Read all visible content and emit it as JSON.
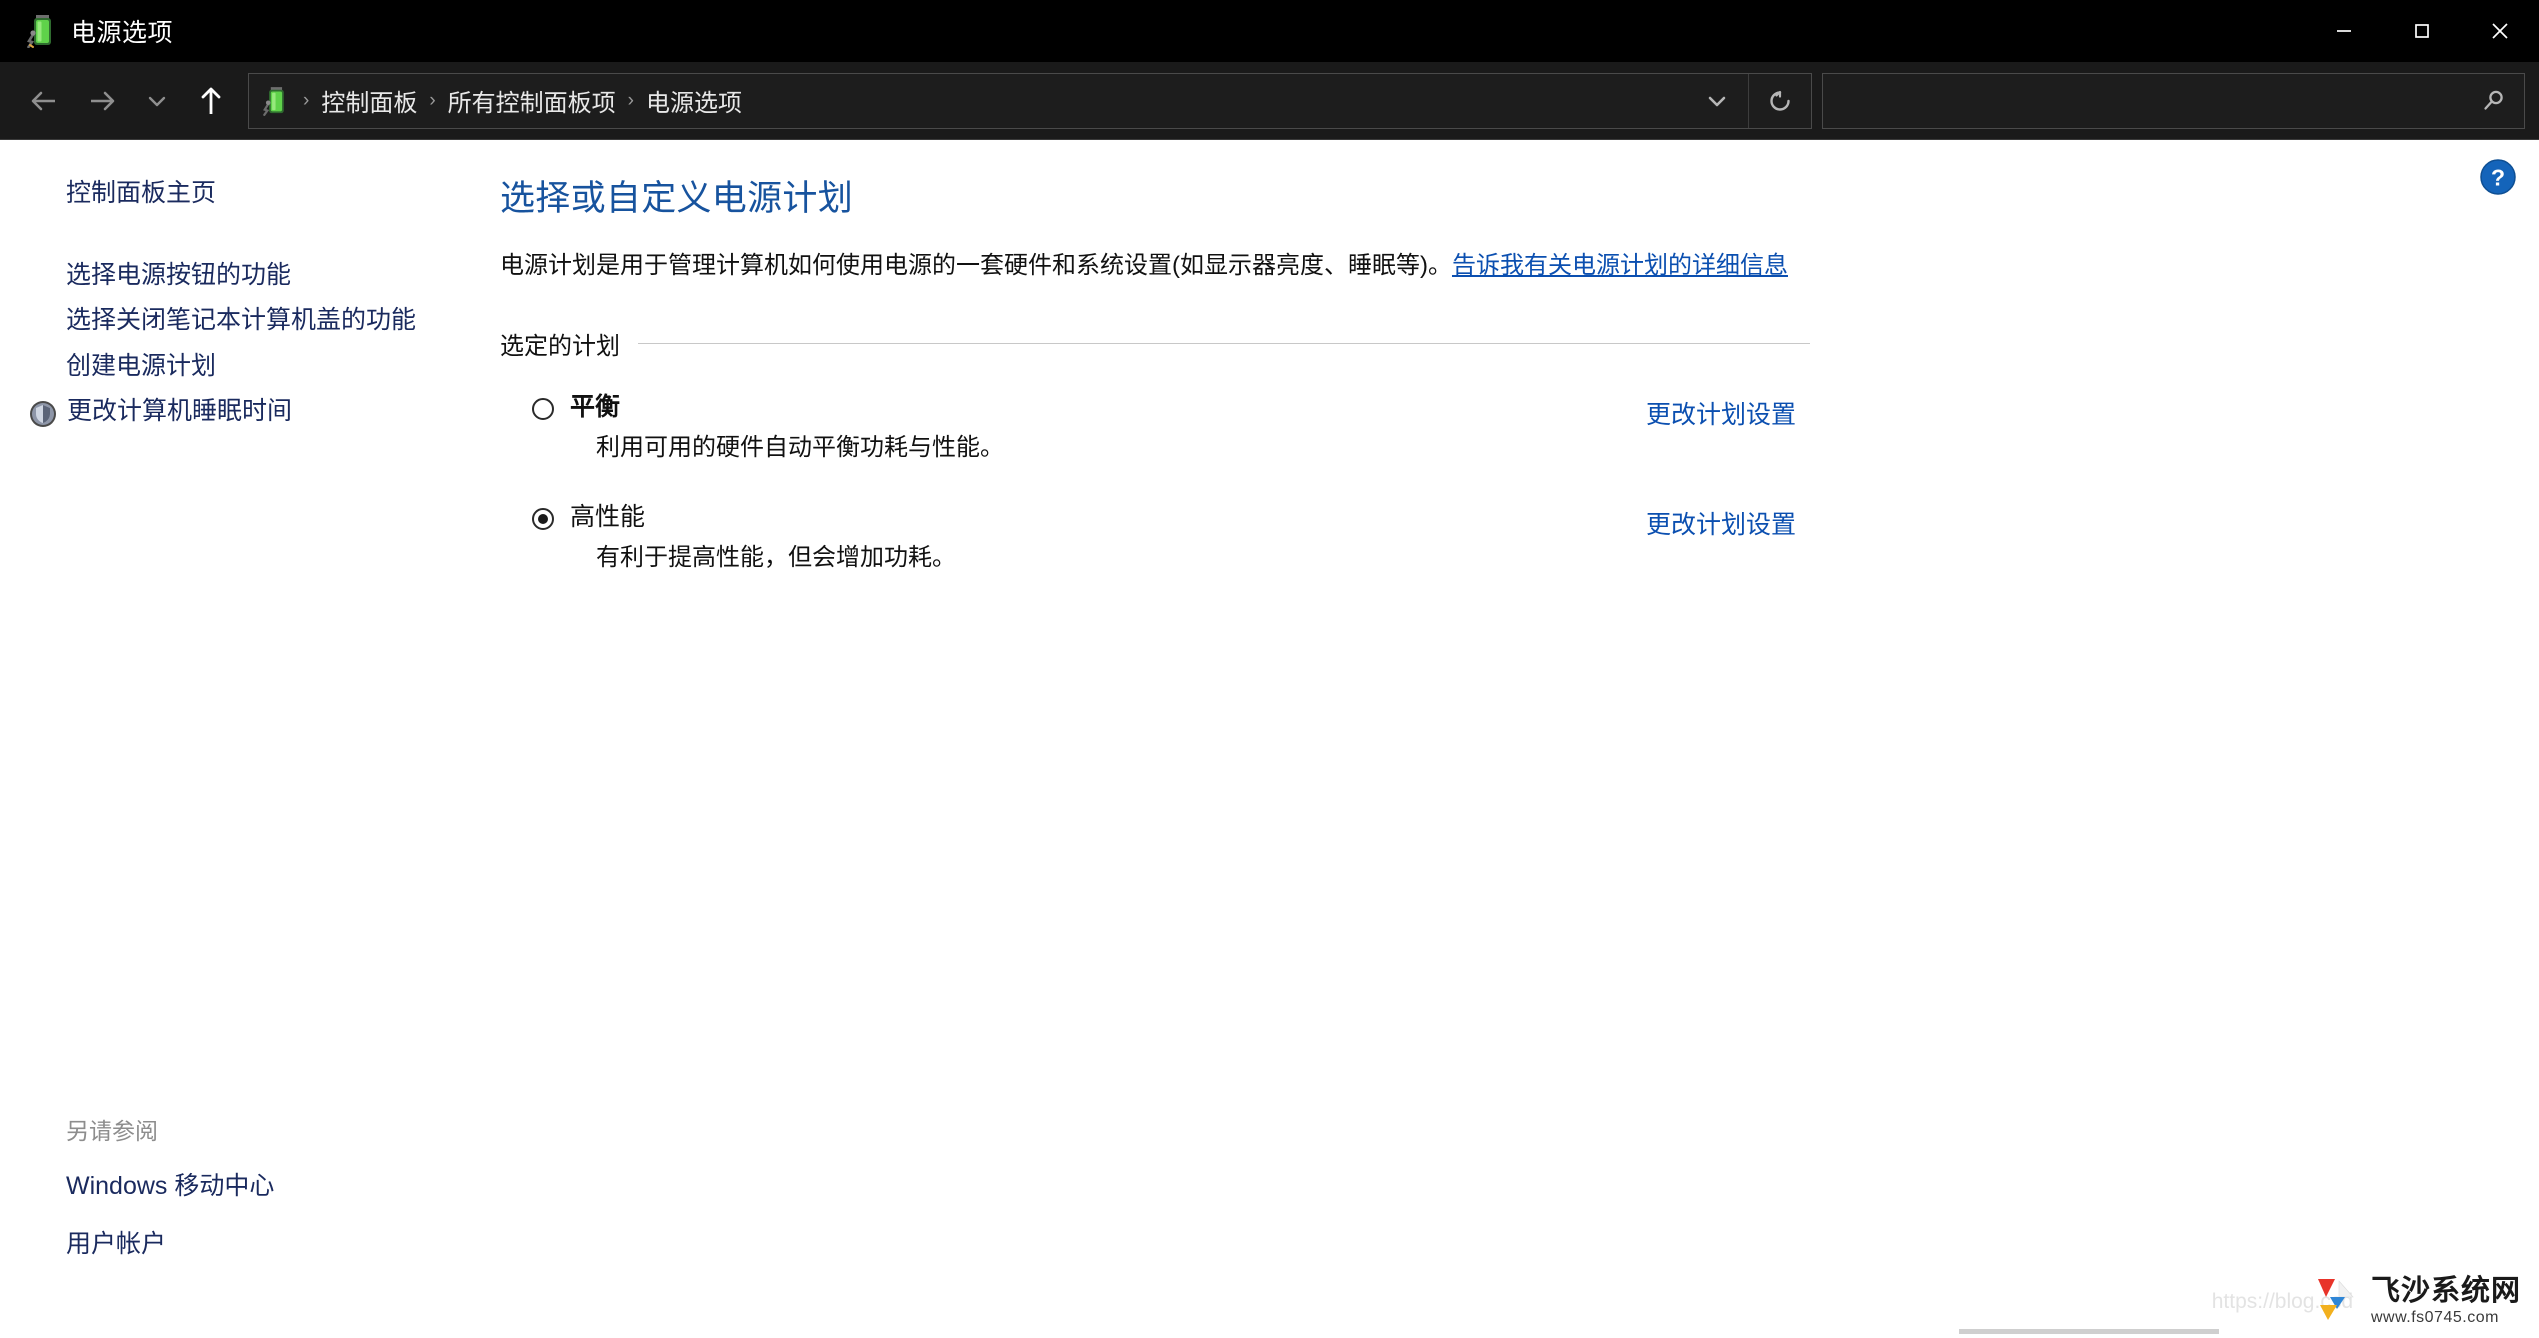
{
  "window": {
    "title": "电源选项",
    "app_icon": "battery-icon",
    "controls": {
      "minimize": "minimize-icon",
      "maximize": "maximize-icon",
      "close": "close-icon"
    }
  },
  "navbar": {
    "back": "back-arrow-icon",
    "forward": "forward-arrow-icon",
    "recent": "chevron-down-icon",
    "up": "up-arrow-icon",
    "address_icon": "battery-icon",
    "breadcrumbs": [
      "控制面板",
      "所有控制面板项",
      "电源选项"
    ],
    "separator": "›",
    "dropdown": "chevron-down-icon",
    "refresh": "refresh-icon",
    "search": {
      "placeholder": "",
      "value": "",
      "icon": "search-icon"
    }
  },
  "sidebar": {
    "home_label": "控制面板主页",
    "links": [
      {
        "label": "选择电源按钮的功能",
        "icon": null
      },
      {
        "label": "选择关闭笔记本计算机盖的功能",
        "icon": null
      },
      {
        "label": "创建电源计划",
        "icon": null
      },
      {
        "label": "更改计算机睡眠时间",
        "icon": "shield-icon"
      }
    ],
    "see_also": {
      "title": "另请参阅",
      "links": [
        "Windows 移动中心",
        "用户帐户"
      ]
    }
  },
  "main": {
    "page_title": "选择或自定义电源计划",
    "description_part1": "电源计划是用于管理计算机如何使用电源的一套硬件和系统设置(如显示器亮度、睡眠等)。",
    "description_link": "告诉我有关电源计划的详细信息",
    "group_label": "选定的计划",
    "plans": [
      {
        "name": "平衡",
        "description": "利用可用的硬件自动平衡功耗与性能。",
        "selected": false,
        "bold": true,
        "action_label": "更改计划设置"
      },
      {
        "name": "高性能",
        "description": "有利于提高性能，但会增加功耗。",
        "selected": true,
        "bold": false,
        "action_label": "更改计划设置"
      }
    ],
    "help_icon": "help-question-icon"
  },
  "watermark": {
    "faint_text": "https://blog.csd",
    "brand": "飞沙系统网",
    "url": "www.fs0745.com"
  },
  "colors": {
    "titlebar_bg": "#000000",
    "navbar_bg": "#1a1a1a",
    "content_bg": "#ffffff",
    "link_blue": "#0b4fb0",
    "sidebar_link": "#1a2a5e",
    "page_title": "#17539e",
    "help_blue": "#1464ba"
  }
}
